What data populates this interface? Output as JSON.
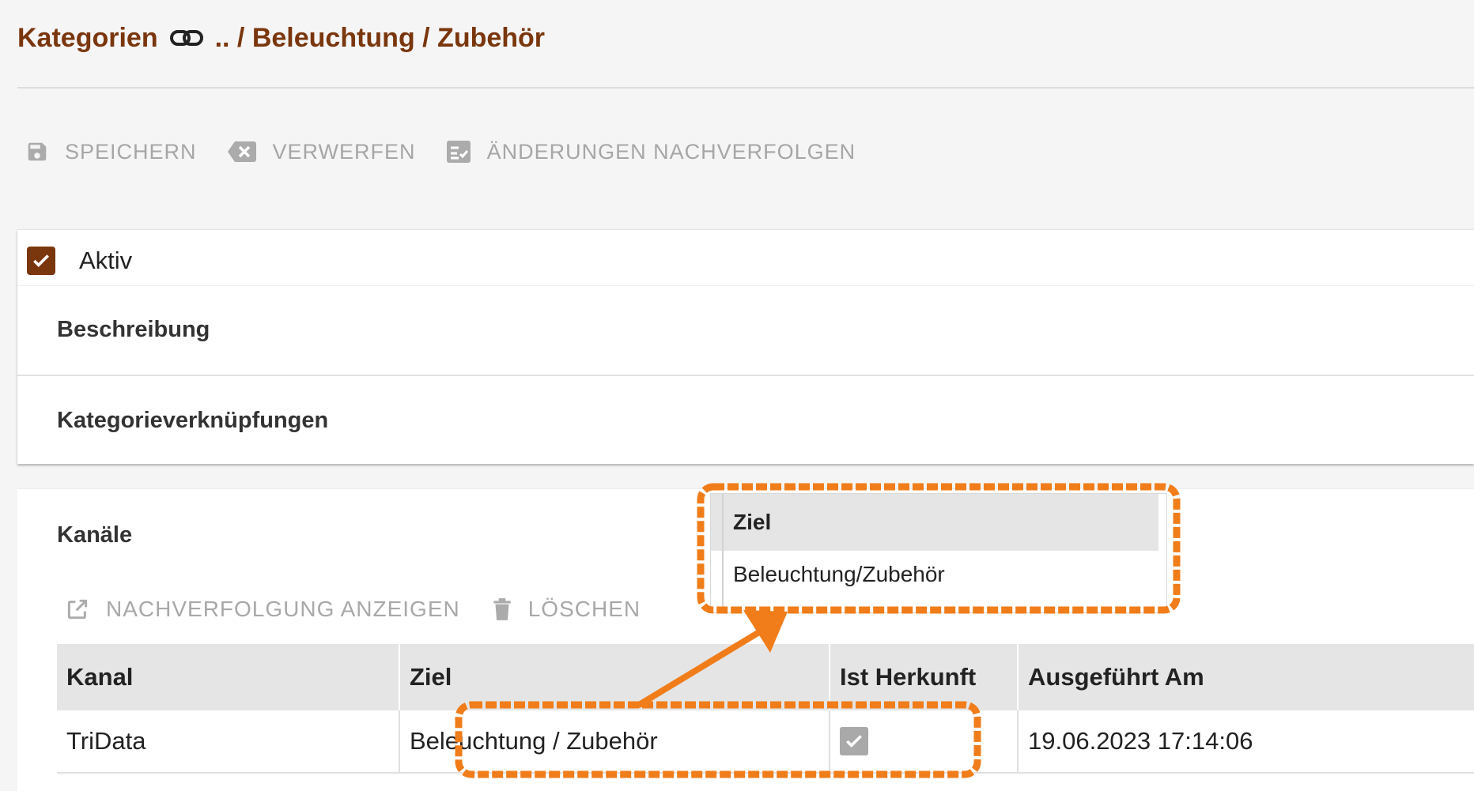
{
  "breadcrumb": {
    "root": "Kategorien",
    "path": ".. / Beleuchtung / Zubehör",
    "link_icon": "link-icon"
  },
  "toolbar": {
    "save": "SPEICHERN",
    "discard": "VERWERFEN",
    "track": "ÄNDERUNGEN NACHVERFOLGEN"
  },
  "form": {
    "active_label": "Aktiv",
    "active_checked": true,
    "description_header": "Beschreibung",
    "links_header": "Kategorieverknüpfungen"
  },
  "channels": {
    "header": "Kanäle",
    "show_tracking": "NACHVERFOLGUNG ANZEIGEN",
    "delete": "LÖSCHEN",
    "columns": [
      "Kanal",
      "Ziel",
      "Ist Herkunft",
      "Ausgeführt Am"
    ],
    "rows": [
      {
        "kanal": "TriData",
        "ziel": "Beleuchtung / Zubehör",
        "ist_herkunft": true,
        "ausgefuehrt_am": "19.06.2023 17:14:06"
      }
    ]
  },
  "callout": {
    "header": "Ziel",
    "value": "Beleuchtung/Zubehör"
  },
  "colors": {
    "accent": "#7a360d",
    "annotation": "#f07d1a",
    "muted": "#a6a6a6"
  }
}
